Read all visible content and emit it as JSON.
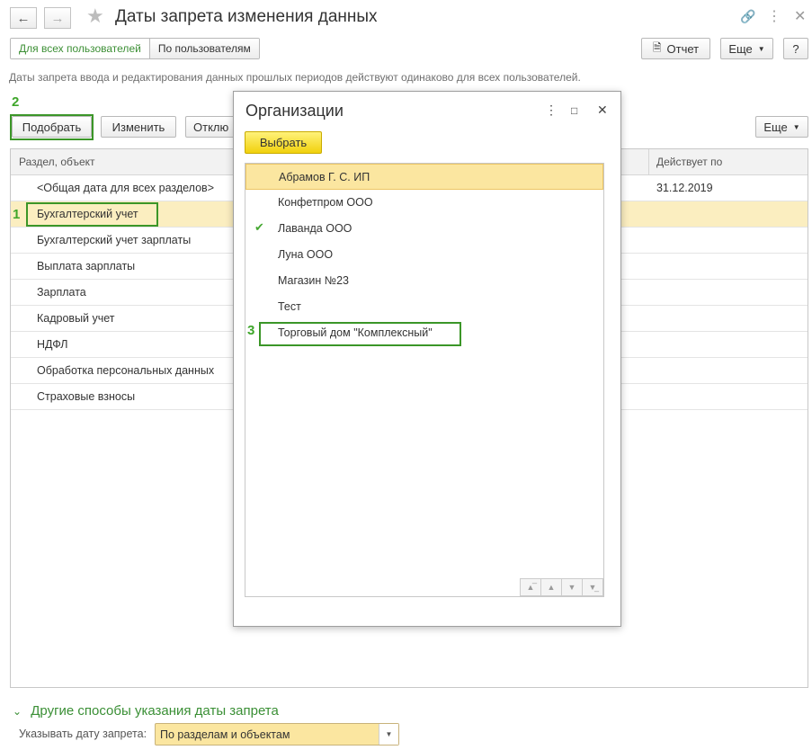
{
  "window": {
    "title": "Даты запрета изменения данных",
    "back_icon": "arrow-left-icon",
    "forward_icon": "arrow-right-icon"
  },
  "tabs": {
    "all_users": "Для всех пользователей",
    "by_user": "По пользователям"
  },
  "toolbar_top": {
    "report": "Отчет",
    "more": "Еще",
    "help": "?"
  },
  "info_text": "Даты запрета ввода и редактирования данных прошлых периодов действуют одинаково для всех пользователей.",
  "annotations": {
    "one": "1",
    "two": "2",
    "three": "3"
  },
  "toolbar": {
    "pick": "Подобрать",
    "change": "Изменить",
    "disable_partial": "Отклю",
    "more": "Еще"
  },
  "table": {
    "columns": [
      "Раздел, объект",
      "Действует по"
    ],
    "rows": [
      {
        "name": "<Общая дата для всех разделов>",
        "date": "31.12.2019"
      },
      {
        "name": "Бухгалтерский учет",
        "date": ""
      },
      {
        "name": "Бухгалтерский учет зарплаты",
        "date": ""
      },
      {
        "name": "Выплата зарплаты",
        "date": ""
      },
      {
        "name": "Зарплата",
        "date": ""
      },
      {
        "name": "Кадровый учет",
        "date": ""
      },
      {
        "name": "НДФЛ",
        "date": ""
      },
      {
        "name": "Обработка персональных данных",
        "date": ""
      },
      {
        "name": "Страховые взносы",
        "date": ""
      }
    ]
  },
  "dialog": {
    "title": "Организации",
    "choose": "Выбрать",
    "items": [
      "Абрамов Г. С. ИП",
      "Конфетпром ООО",
      "Лаванда ООО",
      "Луна ООО",
      "Магазин №23",
      "Тест",
      "Торговый дом \"Комплексный\""
    ]
  },
  "footer": {
    "link": "Другие способы указания даты запрета",
    "label": "Указывать дату запрета:",
    "value": "По разделам и объектам"
  },
  "colors": {
    "accent_green": "#3b9628",
    "selection_yellow": "#fbeec0",
    "button_yellow": "#f1d10d"
  }
}
